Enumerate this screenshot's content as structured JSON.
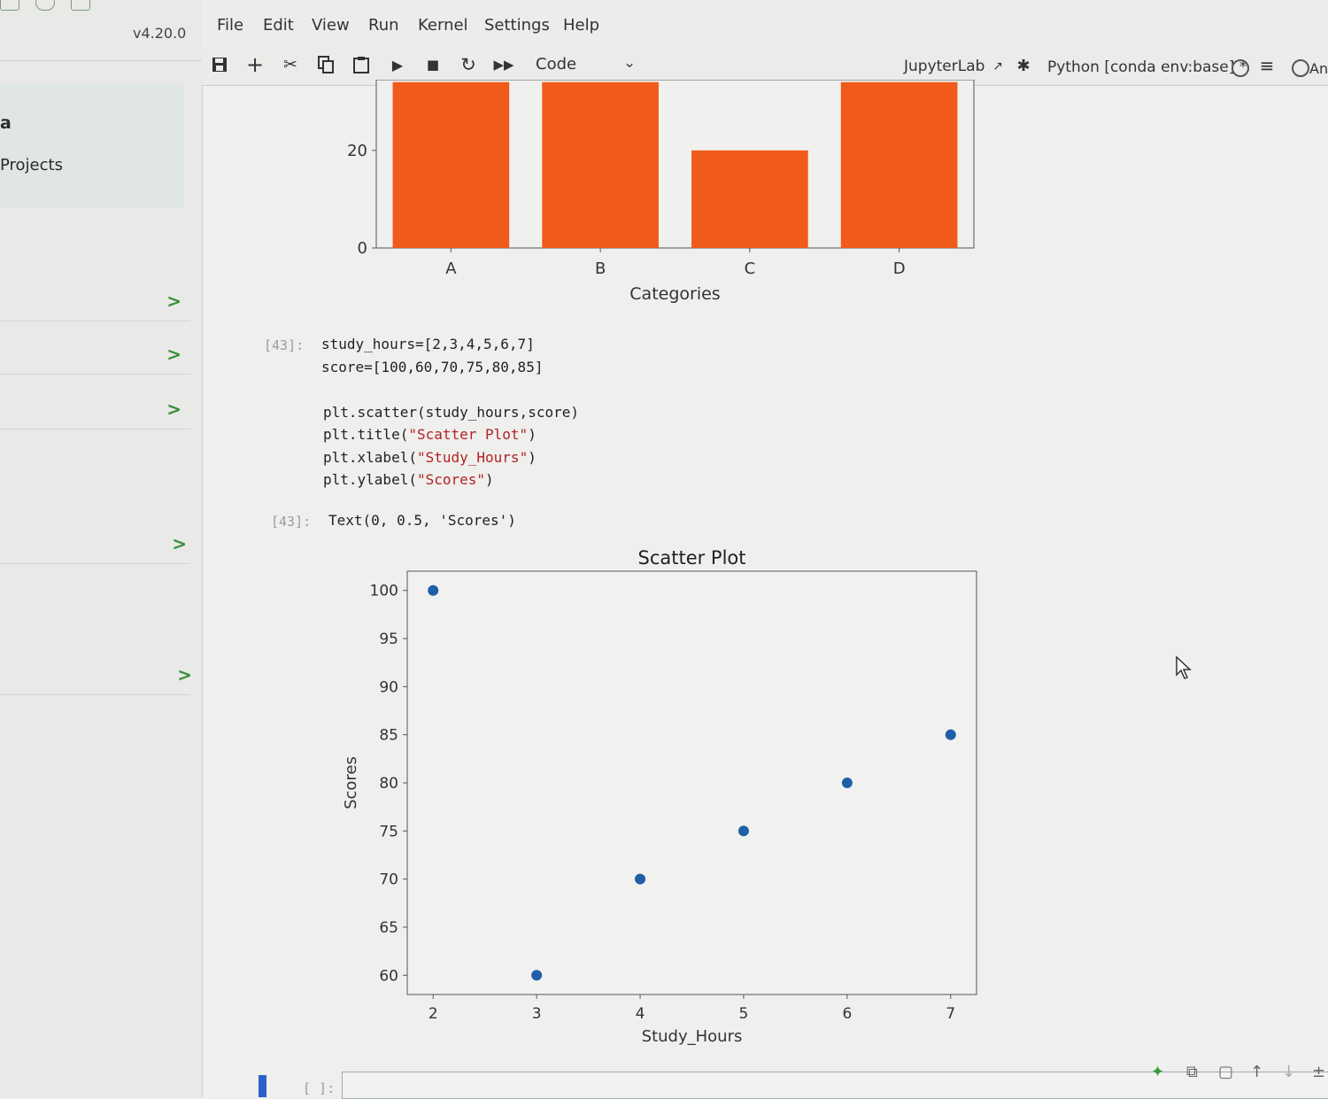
{
  "sidebar": {
    "version": "v4.20.0",
    "title": "a",
    "subtitle": "Projects"
  },
  "menu": [
    "File",
    "Edit",
    "View",
    "Run",
    "Kernel",
    "Settings",
    "Help"
  ],
  "toolbar": {
    "cell_type": "Code",
    "jupyterlab": "JupyterLab",
    "kernel": "Python [conda env:base] *",
    "extra": "An"
  },
  "cell43": {
    "prompt": "[43]:",
    "code": [
      "study_hours=[2,3,4,5,6,7]",
      "score=[100,60,70,75,80,85]",
      "",
      "plt.scatter(study_hours,score)",
      "plt.title(\"Scatter Plot\")",
      "plt.xlabel(\"Study_Hours\")",
      "plt.ylabel(\"Scores\")"
    ],
    "out_prompt": "[43]:",
    "output": "Text(0, 0.5, 'Scores')"
  },
  "bottom_cell": {
    "prompt": "[ ]:"
  },
  "chart_data": [
    {
      "type": "bar",
      "categories": [
        "A",
        "B",
        "C",
        "D"
      ],
      "values": [
        34,
        34,
        20,
        34
      ],
      "title": "",
      "xlabel": "Categories",
      "ylabel": "",
      "yticks": [
        0,
        20
      ],
      "color": "#f05a1a"
    },
    {
      "type": "scatter",
      "x": [
        2,
        3,
        4,
        5,
        6,
        7
      ],
      "y": [
        100,
        60,
        70,
        75,
        80,
        85
      ],
      "title": "Scatter Plot",
      "xlabel": "Study_Hours",
      "ylabel": "Scores",
      "xlim": [
        1.75,
        7.25
      ],
      "ylim": [
        58,
        102
      ],
      "xticks": [
        2,
        3,
        4,
        5,
        6,
        7
      ],
      "yticks": [
        60,
        65,
        70,
        75,
        80,
        85,
        90,
        95,
        100
      ],
      "color": "#1f5fa8"
    }
  ]
}
